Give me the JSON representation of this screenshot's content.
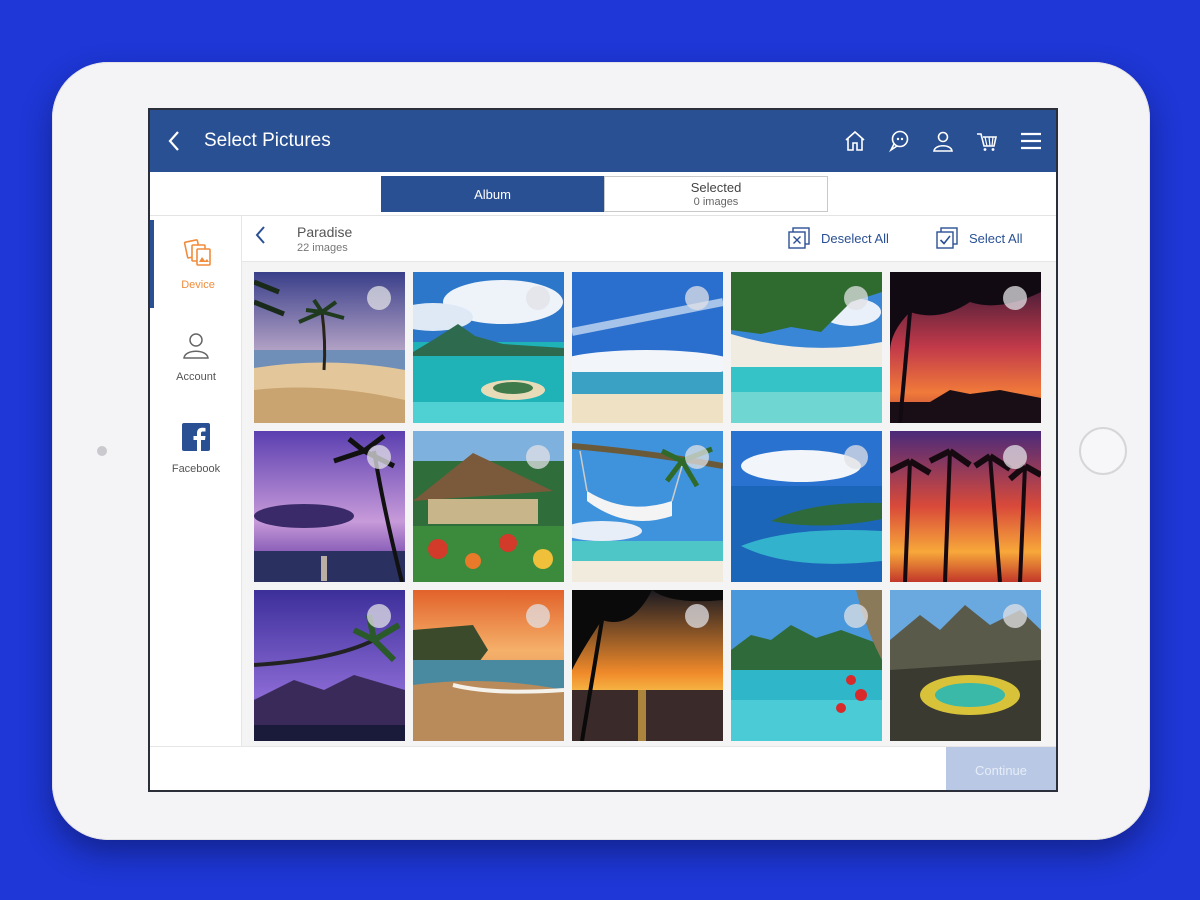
{
  "header": {
    "title": "Select Pictures",
    "icons": [
      "home-icon",
      "chat-icon",
      "user-icon",
      "cart-icon",
      "menu-icon"
    ]
  },
  "tabs": {
    "album_label": "Album",
    "selected_label": "Selected",
    "selected_count": "0 images"
  },
  "sidebar": {
    "items": [
      {
        "label": "Device",
        "icon": "photos-icon",
        "active": true
      },
      {
        "label": "Account",
        "icon": "account-icon",
        "active": false
      },
      {
        "label": "Facebook",
        "icon": "facebook-icon",
        "active": false
      }
    ]
  },
  "album": {
    "name": "Paradise",
    "count": "22 images",
    "deselect_all": "Deselect All",
    "select_all": "Select All"
  },
  "footer": {
    "continue_label": "Continue"
  },
  "colors": {
    "primary": "#2a5094",
    "accent": "#f08c3c",
    "background": "#1e37d6"
  },
  "photos": [
    {
      "scene": "beach-palm-sunset",
      "selected": false
    },
    {
      "scene": "island-lagoon",
      "selected": false
    },
    {
      "scene": "beach-clouds",
      "selected": false
    },
    {
      "scene": "palm-beach-turquoise",
      "selected": false
    },
    {
      "scene": "palm-silhouette-sunset",
      "selected": false
    },
    {
      "scene": "purple-sunset-palm",
      "selected": false
    },
    {
      "scene": "hut-garden",
      "selected": false
    },
    {
      "scene": "hammock-palm",
      "selected": false
    },
    {
      "scene": "atoll-aerial",
      "selected": false
    },
    {
      "scene": "palms-red-sunset",
      "selected": false
    },
    {
      "scene": "purple-dusk-palm",
      "selected": false
    },
    {
      "scene": "cliff-beach-sunset",
      "selected": false
    },
    {
      "scene": "frond-sunset",
      "selected": false
    },
    {
      "scene": "mountain-lagoon-flowers",
      "selected": false
    },
    {
      "scene": "rock-pool-mountains",
      "selected": false
    }
  ]
}
